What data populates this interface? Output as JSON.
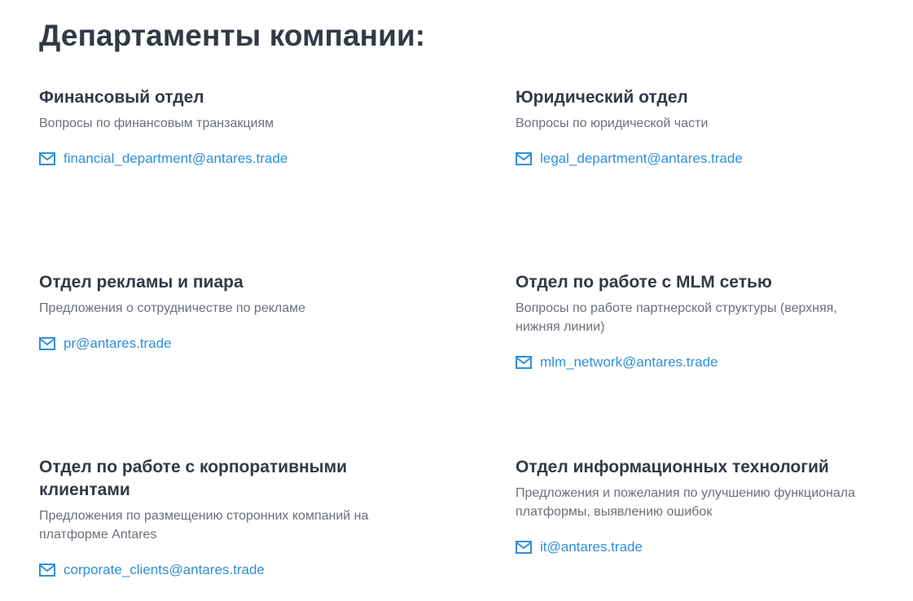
{
  "page": {
    "title": "Департаменты компании:"
  },
  "colors": {
    "link": "#2f8fd8",
    "heading": "#333a46",
    "text": "#6b7079"
  },
  "departments": [
    {
      "name": "Финансовый отдел",
      "description": "Вопросы по финансовым транзакциям",
      "email": "financial_department@antares.trade",
      "icon": "mail-icon"
    },
    {
      "name": "Юридический отдел",
      "description": "Вопросы по юридической части",
      "email": "legal_department@antares.trade",
      "icon": "mail-icon"
    },
    {
      "name": "Отдел рекламы и пиара",
      "description": "Предложения о сотрудничестве по рекламе",
      "email": "pr@antares.trade",
      "icon": "mail-icon"
    },
    {
      "name": "Отдел по работе с MLM сетью",
      "description": "Вопросы по работе партнерской структуры (верхняя, нижняя линии)",
      "email": "mlm_network@antares.trade",
      "icon": "mail-icon"
    },
    {
      "name": "Отдел по работе с корпоративными клиентами",
      "description": "Предложения по размещению сторонних компаний на платформе Antares",
      "email": "corporate_clients@antares.trade",
      "icon": "mail-icon"
    },
    {
      "name": "Отдел информационных технологий",
      "description": "Предложения и пожелания по улучшению функционала платформы, выявлению ошибок",
      "email": "it@antares.trade",
      "icon": "mail-icon"
    }
  ]
}
